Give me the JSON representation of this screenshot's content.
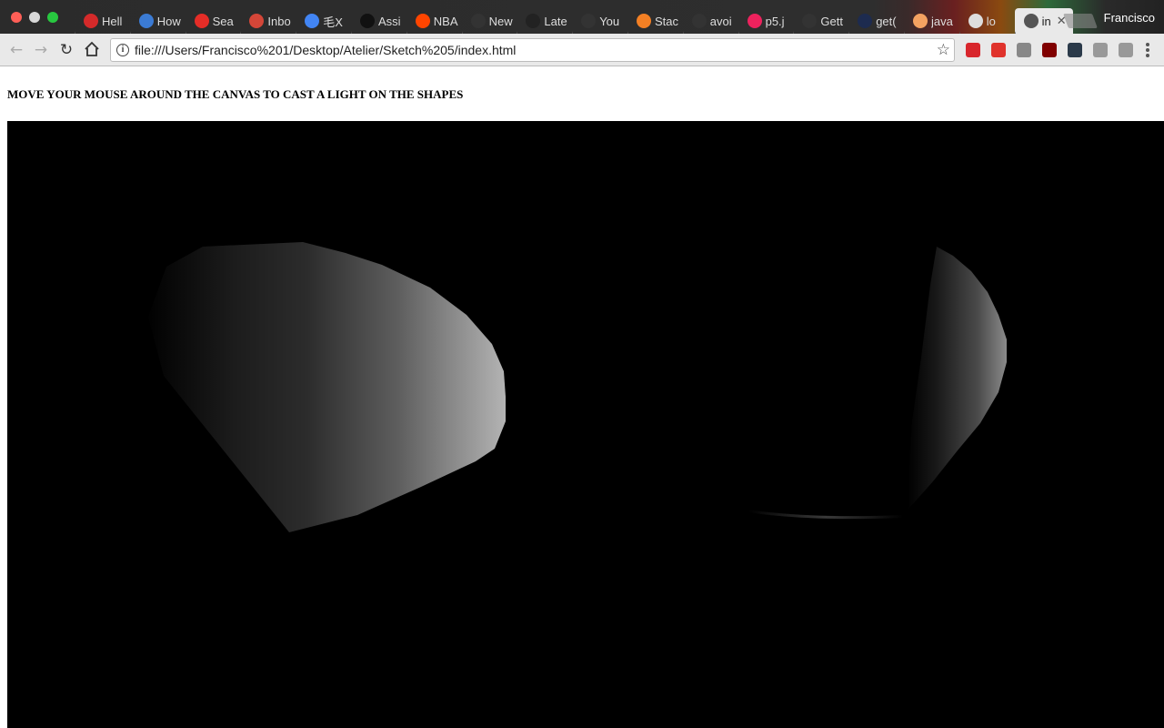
{
  "window": {
    "profile_name": "Francisco",
    "traffic_lights": [
      "#ff5f57",
      "#d8d8d8",
      "#28c840"
    ]
  },
  "tabs": [
    {
      "label": "Hell",
      "icon": "opera-icon",
      "color": "#d42a2a"
    },
    {
      "label": "How",
      "icon": "globe-icon",
      "color": "#3b7bd4"
    },
    {
      "label": "Sea",
      "icon": "youtube-icon",
      "color": "#e52d27"
    },
    {
      "label": "Inbo",
      "icon": "gmail-icon",
      "color": "#d44638"
    },
    {
      "label": "毛X",
      "icon": "google-icon",
      "color": "#4285f4"
    },
    {
      "label": "Assi",
      "icon": "plus-icon",
      "color": "#111111"
    },
    {
      "label": "NBA",
      "icon": "reddit-icon",
      "color": "#ff4500"
    },
    {
      "label": "New",
      "icon": "record-icon",
      "color": "#333333"
    },
    {
      "label": "Late",
      "icon": "quora-icon",
      "color": "#222222"
    },
    {
      "label": "You",
      "icon": "github-icon",
      "color": "#333333"
    },
    {
      "label": "Stac",
      "icon": "stackoverflow-icon",
      "color": "#f48024"
    },
    {
      "label": "avoi",
      "icon": "github-icon",
      "color": "#333333"
    },
    {
      "label": "p5.j",
      "icon": "star-icon",
      "color": "#ed225d"
    },
    {
      "label": "Gett",
      "icon": "github-icon",
      "color": "#333333"
    },
    {
      "label": "get(",
      "icon": "p-icon",
      "color": "#1d2b4f"
    },
    {
      "label": "java",
      "icon": "pencil-icon",
      "color": "#f4a261"
    },
    {
      "label": "lo",
      "icon": "page-icon",
      "color": "#dddddd"
    },
    {
      "label": "in",
      "icon": "page-icon",
      "color": "#555555",
      "active": true
    }
  ],
  "toolbar": {
    "url": "file:///Users/Francisco%201/Desktop/Atelier/Sketch%205/index.html",
    "extensions": [
      {
        "icon": "adblock-icon",
        "color": "#d8262c"
      },
      {
        "icon": "mute-icon",
        "color": "#e0332c"
      },
      {
        "icon": "pixel-icon",
        "color": "#888888"
      },
      {
        "icon": "ublock-icon",
        "color": "#800000"
      },
      {
        "icon": "color-icon",
        "color": "#2b3a4a"
      },
      {
        "icon": "h-icon",
        "color": "#999999"
      },
      {
        "icon": "window-icon",
        "color": "#999999"
      }
    ]
  },
  "page": {
    "instruction": "MOVE YOUR MOUSE AROUND THE CANVAS TO CAST A LIGHT ON THE SHAPES"
  }
}
